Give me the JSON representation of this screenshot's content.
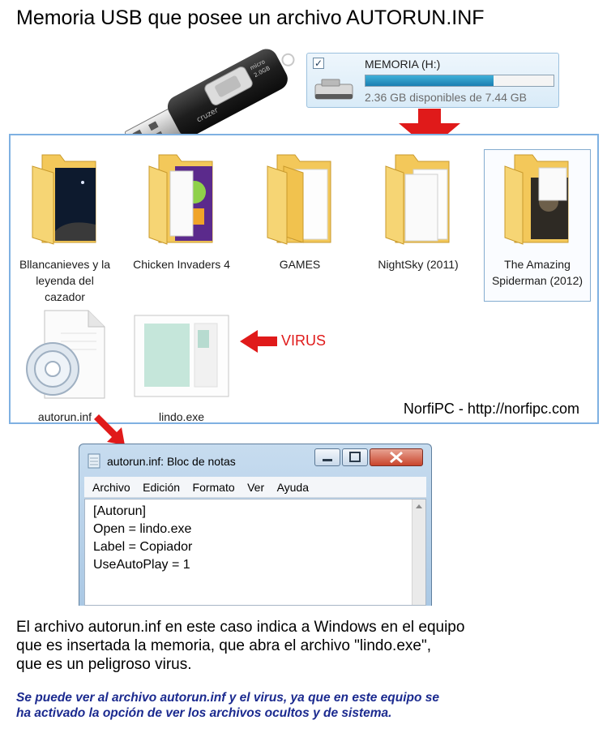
{
  "title": "Memoria USB que posee un archivo AUTORUN.INF",
  "usb_stick": {
    "brand": "cruzer",
    "model": "micro",
    "capacity": "2.0GB"
  },
  "drive": {
    "checked": true,
    "name": "MEMORIA (H:)",
    "free_text": "2.36 GB disponibles de 7.44 GB",
    "used_fraction": 0.68,
    "icon": "usb-drive-icon"
  },
  "explorer": {
    "items": [
      {
        "label": "Bllancanieves y la leyenda del cazador",
        "icon": "folder-icon"
      },
      {
        "label": "Chicken Invaders 4",
        "icon": "folder-icon"
      },
      {
        "label": "GAMES",
        "icon": "folder-icon"
      },
      {
        "label": "NightSky (2011)",
        "icon": "folder-icon"
      },
      {
        "label": "The Amazing Spiderman (2012)",
        "icon": "folder-icon",
        "selected": true
      },
      {
        "label": "autorun.inf",
        "icon": "settings-file-icon"
      },
      {
        "label": "lindo.exe",
        "icon": "executable-icon"
      }
    ],
    "virus_label": "VIRUS",
    "watermark": "NorfiPC - http://norfipc.com"
  },
  "notepad": {
    "title": "autorun.inf: Bloc de notas",
    "menu": [
      "Archivo",
      "Edición",
      "Formato",
      "Ver",
      "Ayuda"
    ],
    "lines": [
      "[Autorun]",
      "Open = lindo.exe",
      "Label = Copiador",
      "UseAutoPlay = 1"
    ]
  },
  "description": [
    "El archivo autorun.inf en este caso indica a Windows en el equipo",
    "que es insertada la memoria, que abra el archivo \"lindo.exe\",",
    "que es un peligroso virus."
  ],
  "note": [
    "Se puede ver al archivo autorun.inf y el virus, ya que en este equipo se",
    "ha activado la opción de ver los archivos ocultos y de sistema."
  ],
  "colors": {
    "arrow": "#e01a1a",
    "panel_border": "#7fb1e2",
    "note": "#1b2a8f",
    "folder": "#f3c85a"
  }
}
